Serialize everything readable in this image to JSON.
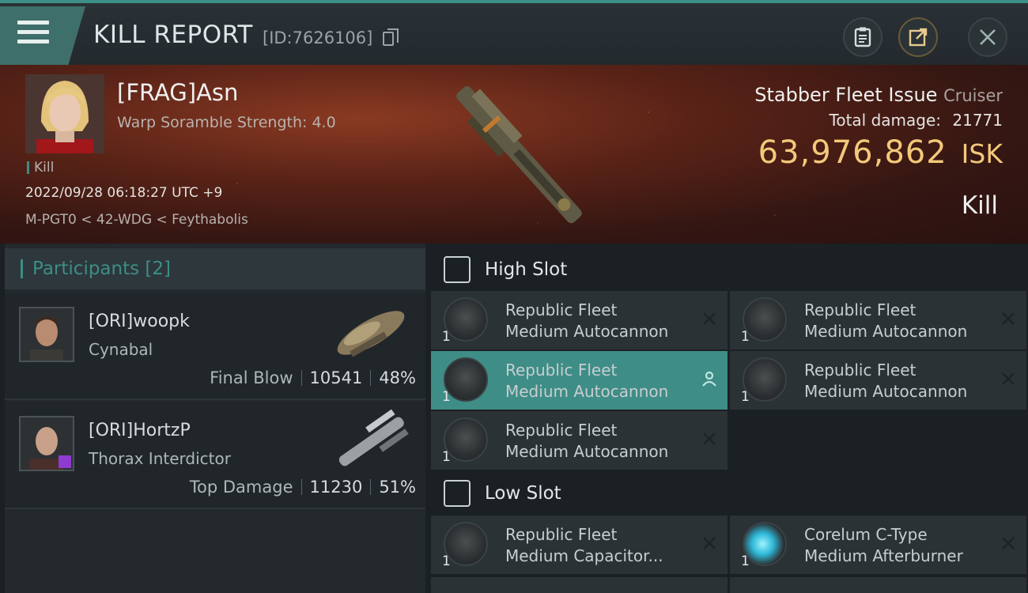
{
  "header": {
    "title": "KILL REPORT",
    "report_id": "[ID:7626106]"
  },
  "victim": {
    "name": "[FRAG]Asn",
    "scramble": "Warp Soramble Strength: 4.0",
    "tag": "Kill",
    "datetime": "2022/09/28 06:18:27 UTC +9",
    "location": "M-PGT0 < 42-WDG < Feythabolis",
    "ship_name": "Stabber Fleet Issue",
    "ship_class": "Cruiser",
    "total_damage_label": "Total damage:",
    "total_damage": "21771",
    "isk_value": "63,976,862",
    "isk_unit": "ISK",
    "kill_type": "Kill"
  },
  "participants": {
    "label": "Participants",
    "count": "[2]",
    "items": [
      {
        "name": "[ORI]woopk",
        "ship": "Cynabal",
        "role": "Final Blow",
        "damage": "10541",
        "percent": "48%"
      },
      {
        "name": "[ORI]HortzP",
        "ship": "Thorax Interdictor",
        "role": "Top Damage",
        "damage": "11230",
        "percent": "51%"
      }
    ]
  },
  "high_slot": {
    "label": "High Slot",
    "modules": [
      {
        "line1": "Republic Fleet",
        "line2": "Medium Autocannon",
        "qty": "1",
        "state": "destroyed"
      },
      {
        "line1": "Republic Fleet",
        "line2": "Medium Autocannon",
        "qty": "1",
        "state": "destroyed"
      },
      {
        "line1": "Republic Fleet",
        "line2": "Medium Autocannon",
        "qty": "1",
        "state": "dropped"
      },
      {
        "line1": "Republic Fleet",
        "line2": "Medium Autocannon",
        "qty": "1",
        "state": "destroyed"
      },
      {
        "line1": "Republic Fleet",
        "line2": "Medium Autocannon",
        "qty": "1",
        "state": "destroyed"
      }
    ]
  },
  "low_slot": {
    "label": "Low Slot",
    "modules": [
      {
        "line1": "Republic Fleet",
        "line2": "Medium Capacitor...",
        "qty": "1",
        "state": "destroyed"
      },
      {
        "line1": "Corelum C-Type",
        "line2": "Medium Afterburner",
        "qty": "1",
        "state": "destroyed"
      }
    ]
  },
  "colors": {
    "accent": "#3e8d86",
    "isk": "#f3c97a",
    "badge": "#8e3bd1"
  },
  "icons": {
    "menu": "hamburger-icon",
    "clipboard": "clipboard-icon",
    "share": "share-icon",
    "close": "close-icon",
    "slot": "slot-icon",
    "pilot": "person-icon",
    "destroyed": "x-icon"
  }
}
